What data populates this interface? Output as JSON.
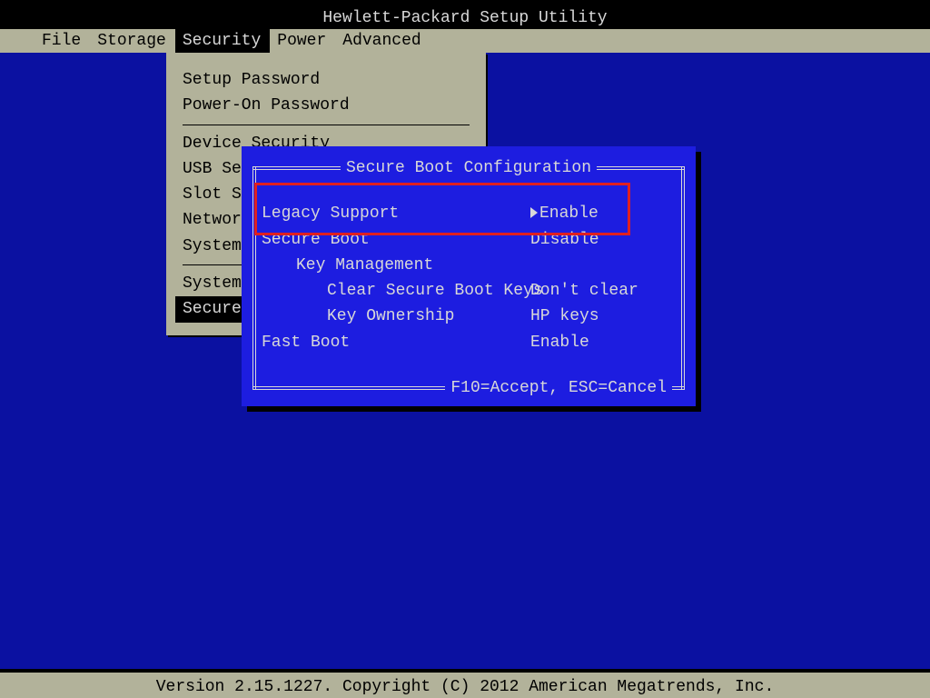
{
  "title": "Hewlett-Packard Setup Utility",
  "menubar": {
    "items": [
      {
        "label": "File"
      },
      {
        "label": "Storage"
      },
      {
        "label": "Security",
        "selected": true
      },
      {
        "label": "Power"
      },
      {
        "label": "Advanced"
      }
    ]
  },
  "security_menu": {
    "group1": [
      "Setup Password",
      "Power-On Password"
    ],
    "group2": [
      "Device Security",
      "USB Security",
      "Slot Security",
      "Network Boot",
      "System IDs"
    ],
    "group3": [
      {
        "label": "System Security",
        "selected": false
      },
      {
        "label": "Secure Boot Configuration",
        "selected": true
      }
    ]
  },
  "dialog": {
    "title": "Secure Boot Configuration",
    "rows": [
      {
        "name": "Legacy Support",
        "value": "Enable",
        "pointer": true,
        "indent": 0
      },
      {
        "name": "Secure Boot",
        "value": "Disable",
        "indent": 0
      },
      {
        "name": "Key Management",
        "value": "",
        "indent": 1
      },
      {
        "name": "Clear Secure Boot Keys",
        "value": "Don't clear",
        "indent": 2
      },
      {
        "name": "Key Ownership",
        "value": "HP keys",
        "indent": 2
      },
      {
        "name": "Fast Boot",
        "value": "Enable",
        "indent": 0
      }
    ],
    "footer": "F10=Accept, ESC=Cancel"
  },
  "footer": "Version 2.15.1227. Copyright (C) 2012 American Megatrends, Inc."
}
